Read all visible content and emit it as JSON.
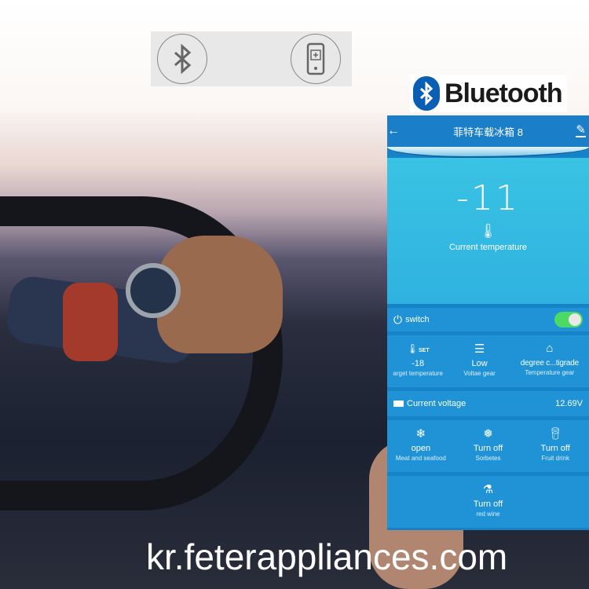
{
  "brand_logo": "Bluetooth",
  "watermark": "kr.feterappliances.com",
  "app": {
    "title": "菲特车载冰箱 8",
    "current_temperature": "-11",
    "current_temperature_label": "Current temperature",
    "switch_label": "switch",
    "switch_on": true,
    "settings": [
      {
        "icon": "thermometer-set-icon",
        "icon_text": "SET",
        "value": "-18",
        "label": "arget  temperature"
      },
      {
        "icon": "menu-lines-icon",
        "value": "Low",
        "label": "Voltae gear"
      },
      {
        "icon": "temperature-gear-icon",
        "value": "degree c...tigrade",
        "label": "Temperature gear"
      }
    ],
    "voltage_label": "Current voltage",
    "voltage_value": "12.69V",
    "modes": [
      {
        "icon": "snowflake-icon",
        "value": "open",
        "label": "Meat and seafood"
      },
      {
        "icon": "snowflake-drops-icon",
        "value": "Turn off",
        "label": "Sorbetes"
      },
      {
        "icon": "cup-icon",
        "value": "Turn off",
        "label": "Fruit drink"
      }
    ],
    "extra_mode": {
      "icon": "flask-icon",
      "value": "Turn off",
      "label": "red wine"
    }
  },
  "colors": {
    "header": "#1a7fc8",
    "toggle_on": "#4cd964",
    "panel": "#1f93d6"
  }
}
